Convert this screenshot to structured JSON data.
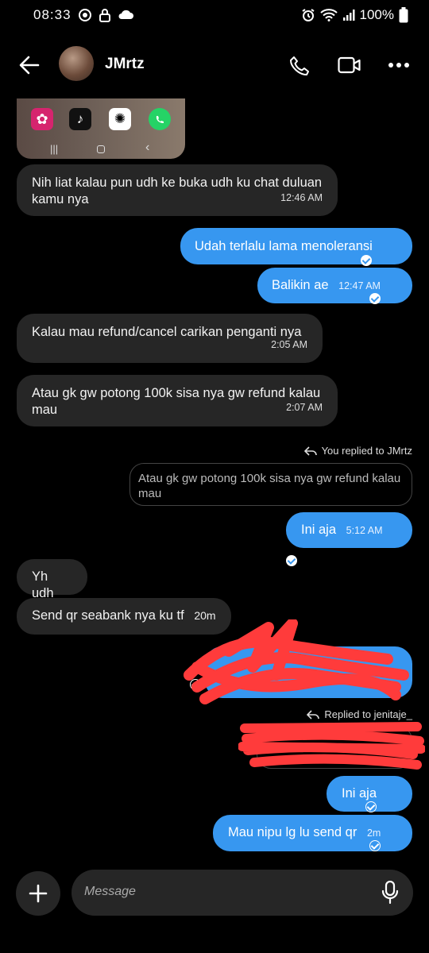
{
  "status_bar": {
    "time": "08:33",
    "battery": "100%"
  },
  "header": {
    "contact_name": "JMrtz"
  },
  "messages": [
    {
      "text": "Nih liat kalau pun udh ke buka udh ku chat duluan kamu nya",
      "time": "12:46 AM"
    },
    {
      "text": "Udah terlalu lama menoleransi"
    },
    {
      "text": "Balikin ae",
      "time": "12:47 AM"
    },
    {
      "text": "Kalau mau refund/cancel carikan penganti nya",
      "time": "2:05 AM"
    },
    {
      "text": "Atau gk gw potong 100k sisa nya gw refund kalau mau",
      "time": "2:07 AM"
    },
    {
      "reply_label": "You replied to JMrtz",
      "quoted": "Atau gk gw potong 100k sisa nya gw refund kalau mau",
      "text": "Ini aja",
      "time": "5:12 AM"
    },
    {
      "text": "Yh udh"
    },
    {
      "text": "Send qr seabank nya ku tf",
      "time": "20m"
    },
    {
      "reply_label": "Replied to jenitaje_"
    },
    {
      "text": "Ini aja"
    },
    {
      "text": "Mau nipu lg lu send qr",
      "time": "2m"
    }
  ],
  "composer": {
    "placeholder": "Message"
  },
  "colors": {
    "outgoing": "#3797f0",
    "incoming": "#262626",
    "redaction": "#ff3b3b"
  }
}
